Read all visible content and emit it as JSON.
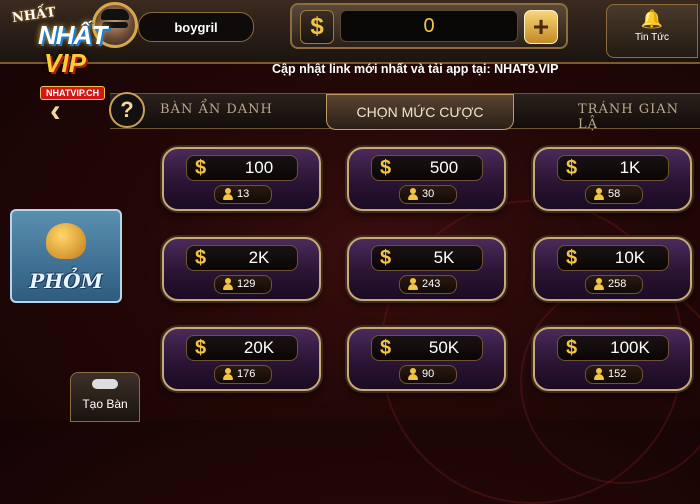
{
  "logo": {
    "line1": "NHẤT",
    "line2": "NHẤT",
    "line3": "VIP",
    "url": "NHATVIP.CH"
  },
  "user": {
    "name": "boygril"
  },
  "balance": {
    "currency_icon": "$",
    "value": "0",
    "add_icon": "+"
  },
  "news": {
    "label": "Tin Tức"
  },
  "notice": "Cập nhật link mới nhất và tải app tại: NHAT9.VIP",
  "tabs": {
    "left": "BÀN ẨN DANH",
    "active": "CHỌN MỨC CƯỢC",
    "right": "TRÁNH GIAN LẬ"
  },
  "help": "?",
  "game": {
    "name": "PHỎM"
  },
  "create_table": {
    "label": "Tạo Bàn"
  },
  "bets": [
    {
      "amount": "100",
      "players": "13"
    },
    {
      "amount": "500",
      "players": "30"
    },
    {
      "amount": "1K",
      "players": "58"
    },
    {
      "amount": "2K",
      "players": "129"
    },
    {
      "amount": "5K",
      "players": "243"
    },
    {
      "amount": "10K",
      "players": "258"
    },
    {
      "amount": "20K",
      "players": "176"
    },
    {
      "amount": "50K",
      "players": "90"
    },
    {
      "amount": "100K",
      "players": "152"
    }
  ],
  "colors": {
    "accent_gold": "#f4c542",
    "card_purple": "#2b1434",
    "background": "#230707"
  }
}
